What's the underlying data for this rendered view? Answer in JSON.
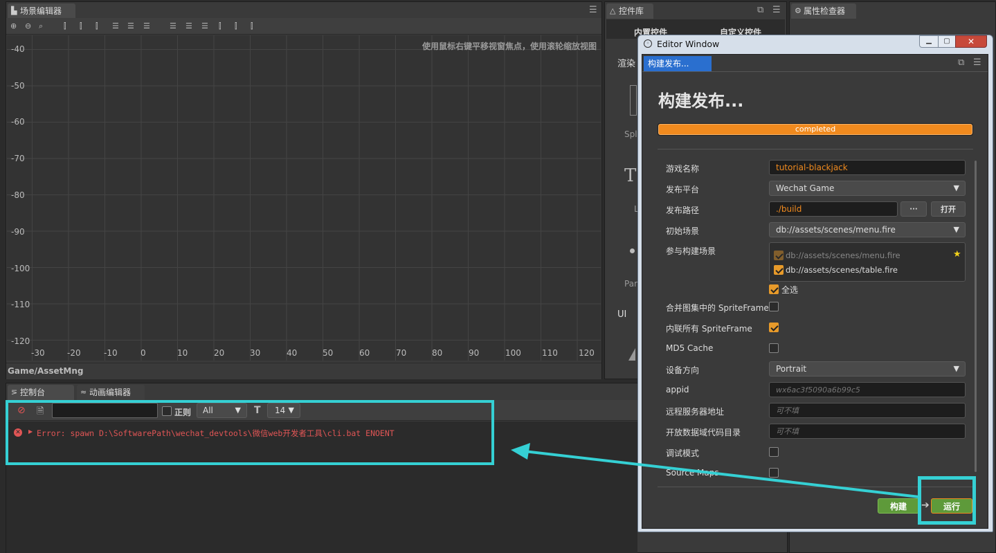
{
  "scene_editor": {
    "tab": "场景编辑器",
    "hint": "使用鼠标右键平移视窗焦点，使用滚轮缩放视图",
    "y_labels": [
      "-40",
      "-50",
      "-60",
      "-70",
      "-80",
      "-90",
      "-100",
      "-110",
      "-120"
    ],
    "x_labels": [
      "-30",
      "-20",
      "-10",
      "0",
      "10",
      "20",
      "30",
      "40",
      "50",
      "60",
      "70",
      "80",
      "90",
      "100",
      "110",
      "120"
    ],
    "breadcrumb": "Game/AssetMng"
  },
  "widget_lib": {
    "tab": "控件库",
    "subtab_builtin": "内置控件",
    "subtab_custom": "自定义控件",
    "render_label": "渲染",
    "items": [
      "Spl",
      "Lı",
      "Par",
      "UI"
    ],
    "big_t": "T"
  },
  "inspector": {
    "tab": "属性检查器"
  },
  "console": {
    "tab_console": "控制台",
    "tab_anim": "动画编辑器",
    "regex_label": "正则",
    "filter_value": "All",
    "font_size": "14",
    "error_text": "Error: spawn D:\\SoftwarePath\\wechat_devtools\\微信web开发者工具\\cli.bat ENOENT"
  },
  "editor_window": {
    "title": "Editor Window",
    "tab": "构建发布...",
    "heading": "构建发布...",
    "progress_text": "completed",
    "progress": 1.0,
    "fields": {
      "game_name_label": "游戏名称",
      "game_name": "tutorial-blackjack",
      "platform_label": "发布平台",
      "platform": "Wechat Game",
      "path_label": "发布路径",
      "path": "./build",
      "browse": "···",
      "open": "打开",
      "start_scene_label": "初始场景",
      "start_scene": "db://assets/scenes/menu.fire",
      "scenes_label": "参与构建场景",
      "scene_1": "db://assets/scenes/menu.fire",
      "scene_2": "db://assets/scenes/table.fire",
      "select_all": "全选",
      "merge_label": "合并图集中的 SpriteFrame",
      "inline_label": "内联所有 SpriteFrame",
      "md5_label": "MD5 Cache",
      "orientation_label": "设备方向",
      "orientation": "Portrait",
      "appid_label": "appid",
      "appid_placeholder": "wx6ac3f5090a6b99c5",
      "remote_label": "远程服务器地址",
      "remote_placeholder": "可不填",
      "open_data_label": "开放数据域代码目录",
      "open_data_placeholder": "可不填",
      "debug_label": "调试模式",
      "sourcemap_label": "Source Maps"
    },
    "build_button": "构建",
    "run_button": "运行"
  },
  "colors": {
    "highlight": "#35d0d4",
    "accent": "#e79a2a",
    "error": "#e05555"
  }
}
